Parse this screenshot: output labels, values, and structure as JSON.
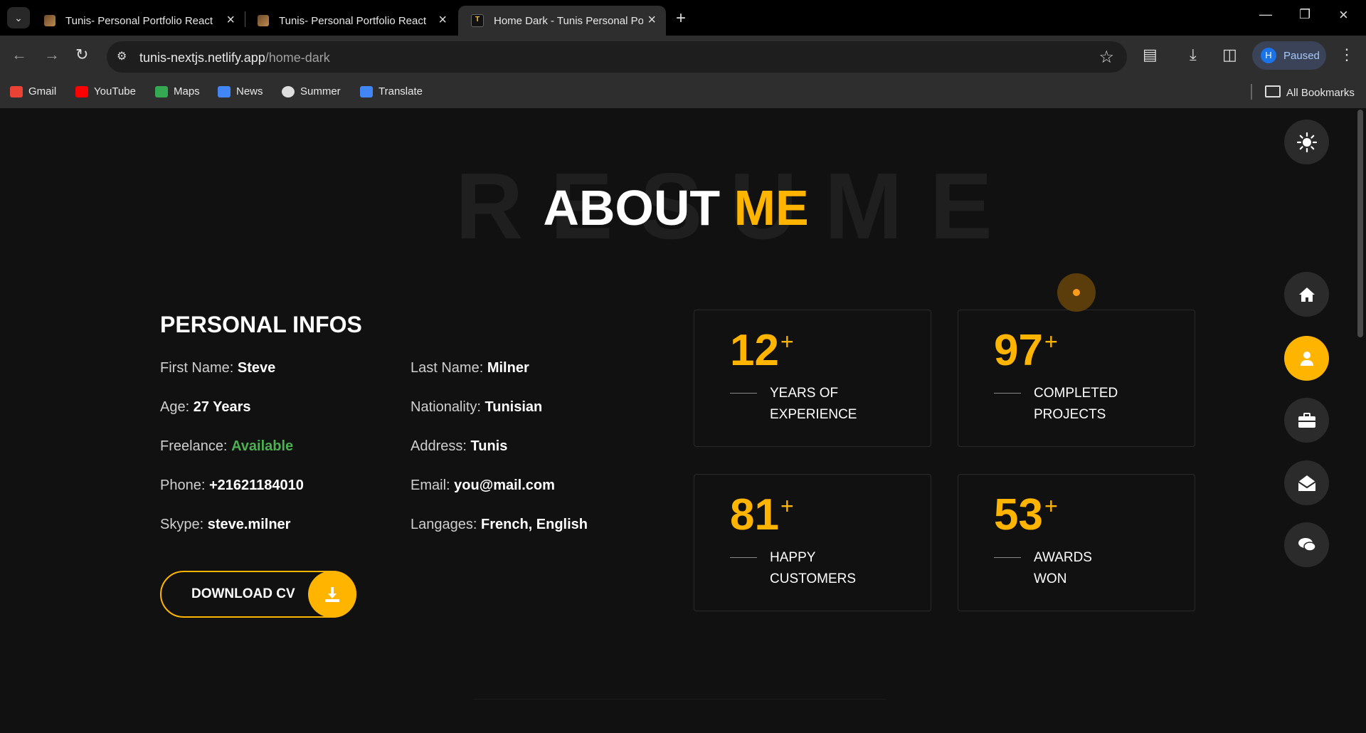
{
  "browser": {
    "tabs": [
      {
        "title": "Tunis- Personal Portfolio React",
        "favicon": "portfolio-favicon",
        "active": false
      },
      {
        "title": "Tunis- Personal Portfolio React",
        "favicon": "portfolio-favicon",
        "active": false
      },
      {
        "title": "Home Dark - Tunis Personal Por",
        "favicon": "tunis-favicon",
        "active": true
      }
    ],
    "url_host": "tunis-nextjs.netlify.app",
    "url_path": "/home-dark",
    "profile_initial": "H",
    "profile_status": "Paused",
    "bookmarks": [
      {
        "label": "Gmail",
        "icon": "gmail-icon",
        "color": "#ea4335"
      },
      {
        "label": "YouTube",
        "icon": "youtube-icon",
        "color": "#ff0000"
      },
      {
        "label": "Maps",
        "icon": "maps-icon",
        "color": "#34a853"
      },
      {
        "label": "News",
        "icon": "news-icon",
        "color": "#4285f4"
      },
      {
        "label": "Summer",
        "icon": "globe-icon",
        "color": "#dddddd"
      },
      {
        "label": "Translate",
        "icon": "translate-icon",
        "color": "#4285f4"
      }
    ],
    "all_bookmarks": "All Bookmarks"
  },
  "page": {
    "background_word": "RESUME",
    "heading_white": "ABOUT",
    "heading_yellow": "ME",
    "accent_color": "#ffb400",
    "section_title": "PERSONAL INFOS",
    "info_left": [
      {
        "label": "First Name:",
        "value": "Steve"
      },
      {
        "label": "Age:",
        "value": "27 Years"
      },
      {
        "label": "Freelance:",
        "value": "Available"
      },
      {
        "label": "Phone:",
        "value": "+21621184010"
      },
      {
        "label": "Skype:",
        "value": "steve.milner"
      }
    ],
    "info_right": [
      {
        "label": "Last Name:",
        "value": "Milner"
      },
      {
        "label": "Nationality:",
        "value": "Tunisian"
      },
      {
        "label": "Address:",
        "value": "Tunis"
      },
      {
        "label": "Email:",
        "value": "you@mail.com"
      },
      {
        "label": "Langages:",
        "value": "French, English"
      }
    ],
    "download_button": "DOWNLOAD CV",
    "stats": [
      {
        "number": "12",
        "plus": "+",
        "line1": "YEARS OF",
        "line2": "EXPERIENCE"
      },
      {
        "number": "97",
        "plus": "+",
        "line1": "COMPLETED",
        "line2": "PROJECTS"
      },
      {
        "number": "81",
        "plus": "+",
        "line1": "HAPPY",
        "line2": "CUSTOMERS"
      },
      {
        "number": "53",
        "plus": "+",
        "line1": "AWARDS",
        "line2": "WON"
      }
    ],
    "side_nav": [
      "home-icon",
      "user-icon",
      "briefcase-icon",
      "envelope-open-icon",
      "chat-icon"
    ],
    "active_nav": "user-icon",
    "theme_toggle": "sun-icon"
  }
}
